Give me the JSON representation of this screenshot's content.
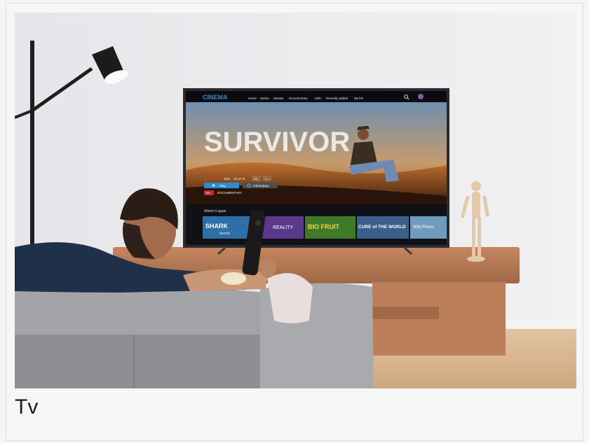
{
  "caption": "Tv",
  "tv": {
    "brand": "CINEMA",
    "nav": [
      "Home",
      "Series",
      "Movies",
      "Documentary",
      "Kids",
      "Recently added",
      "My list"
    ],
    "hero": {
      "title": "SURVIVOR",
      "match": "97% Match",
      "year": "2021",
      "duration": "1h 47 m",
      "quality": "HD",
      "audio": "5.1",
      "age_rating": "16+",
      "genre": "DOCUMENTARY",
      "play_label": "Play",
      "info_label": "Information"
    },
    "row_title": "Watch it again",
    "thumbnails": [
      {
        "title": "SHARK",
        "subtitle": "friends",
        "color": "#2e6fa7"
      },
      {
        "title": "REALITY",
        "color": "#5b3a8e"
      },
      {
        "title": "BIO FRUIT",
        "color": "#3f7a2a"
      },
      {
        "title": "CURE of THE WORLD",
        "color": "#3a5f8a"
      },
      {
        "title": "Wild Rivers",
        "color": "#6f9bbf"
      }
    ]
  },
  "colors": {
    "wall": "#ebebee",
    "floor": "#d9b895",
    "sofa": "#9a9b9d",
    "table": "#b77a52",
    "screen_accent": "#2c8ad6"
  }
}
